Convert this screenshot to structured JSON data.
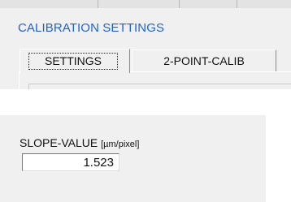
{
  "calibration_group": {
    "title": "CALIBRATION SETTINGS",
    "tabs": [
      {
        "label": "SETTINGS",
        "active": true
      },
      {
        "label": "2-POINT-CALIB",
        "active": false
      }
    ]
  },
  "slope": {
    "label": "SLOPE-VALUE",
    "unit": "[µm/pixel]",
    "value": "1.523"
  },
  "colors": {
    "group_title": "#1c63d6",
    "panel_background": "#f0f0f0"
  }
}
